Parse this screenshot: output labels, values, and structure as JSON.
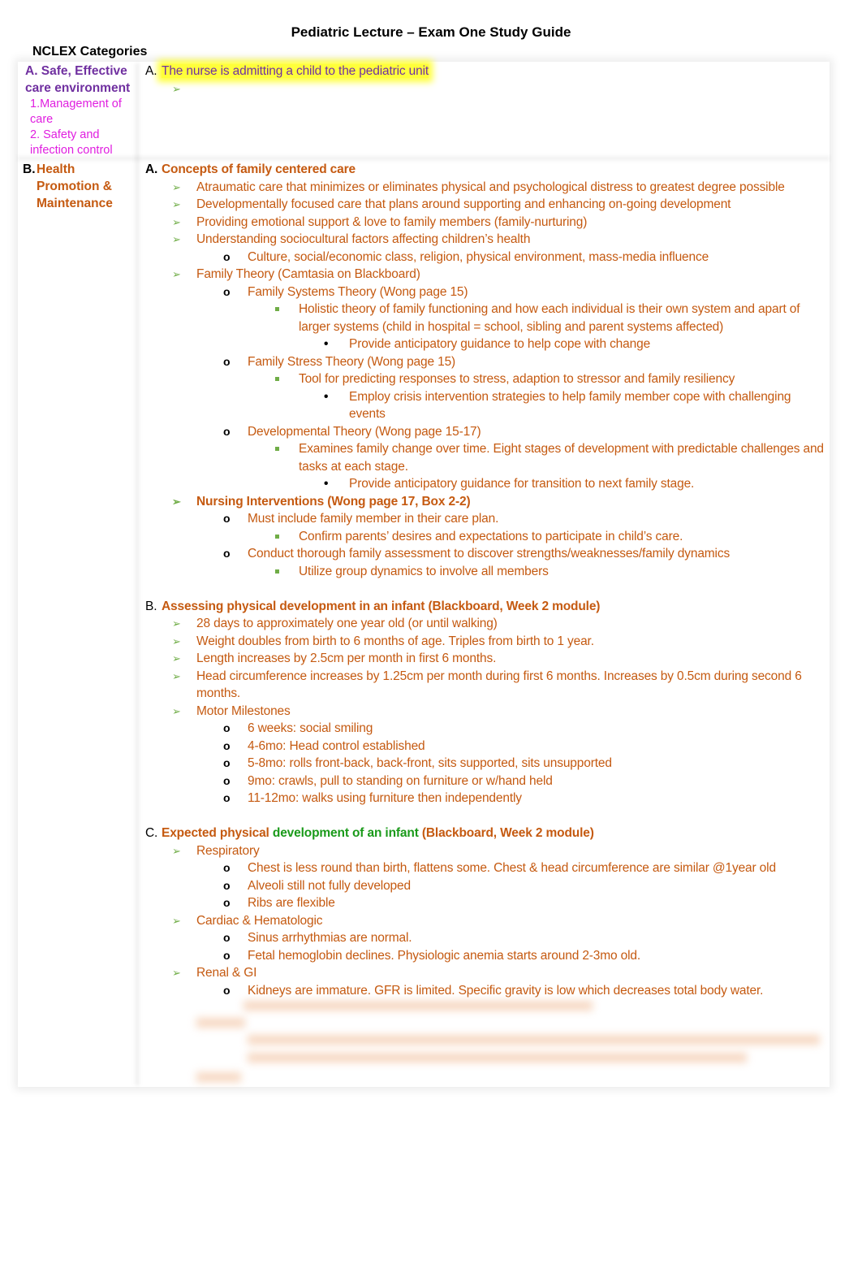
{
  "title": "Pediatric Lecture – Exam One Study Guide",
  "nclex_header": "NCLEX Categories",
  "left": {
    "a_label": "A. Safe, Effective care environment",
    "a_sub1": "1.Management of care",
    "a_sub2": "2. Safety and infection control",
    "b_marker": "B.",
    "b_label": "Health Promotion & Maintenance"
  },
  "colors": {
    "orange": "#c55a11",
    "purple": "#7030a0",
    "magenta": "#e01ee0",
    "arrow_green": "#70ad47",
    "text_green": "#1a9a1a",
    "highlight": "#ffff3a"
  },
  "icons": {
    "level1": "arrowhead-bullet-icon",
    "level2": "o-bullet",
    "level3": "square-bullet-icon",
    "level4": "dot-bullet-icon"
  },
  "row_a": {
    "label": "A.",
    "title": "The nurse is admitting a child to the pediatric unit",
    "items": [
      {
        "level": 1,
        "text": ""
      }
    ]
  },
  "sections": [
    {
      "label": "A.",
      "title": [
        {
          "t": "Concepts of family centered care"
        }
      ],
      "items": [
        {
          "level": 1,
          "text": "Atraumatic care that minimizes or eliminates physical and psychological distress to greatest degree possible"
        },
        {
          "level": 1,
          "text": "Developmentally focused care that plans around supporting and enhancing on-going development"
        },
        {
          "level": 1,
          "text": "Providing emotional support & love to family members (family-nurturing)"
        },
        {
          "level": 1,
          "text": "Understanding sociocultural factors affecting children’s health"
        },
        {
          "level": 2,
          "text": "Culture, social/economic class, religion, physical environment, mass-media influence"
        },
        {
          "level": 1,
          "text": "Family Theory (Camtasia on Blackboard)"
        },
        {
          "level": 2,
          "text": "Family Systems Theory (Wong page 15)"
        },
        {
          "level": 3,
          "text": "Holistic theory of family functioning and how each individual is their own system and apart of larger systems (child in hospital = school, sibling and parent systems affected)"
        },
        {
          "level": 4,
          "text": "Provide anticipatory guidance to help cope with change"
        },
        {
          "level": 2,
          "text": "Family Stress Theory (Wong page 15)"
        },
        {
          "level": 3,
          "text": "Tool for predicting responses to stress, adaption to stressor and family resiliency"
        },
        {
          "level": 4,
          "text": "Employ crisis intervention strategies to help family member cope with challenging events"
        },
        {
          "level": 2,
          "text": "Developmental Theory (Wong page 15-17)"
        },
        {
          "level": 3,
          "text": "Examines family change over time. Eight stages of development with predictable challenges and tasks at each stage."
        },
        {
          "level": 4,
          "text": "Provide anticipatory guidance for transition to next family stage."
        },
        {
          "level": 1,
          "text": "Nursing Interventions (Wong page 17, Box 2-2)",
          "bold": true
        },
        {
          "level": 2,
          "text": "Must include family member in their care plan."
        },
        {
          "level": 3,
          "text": "Confirm parents’ desires and expectations to participate in child’s care."
        },
        {
          "level": 2,
          "text": "Conduct thorough family assessment to discover strengths/weaknesses/family dynamics"
        },
        {
          "level": 3,
          "text": "Utilize group dynamics to involve all members"
        }
      ]
    },
    {
      "label": "B.",
      "title": [
        {
          "t": "Assessing physical development in an infant (Blackboard, Week 2 module)"
        }
      ],
      "items": [
        {
          "level": 1,
          "text": "28 days to approximately one year old (or until walking)"
        },
        {
          "level": 1,
          "text": "Weight doubles from birth to 6 months of age. Triples from birth to 1 year."
        },
        {
          "level": 1,
          "text": "Length increases by 2.5cm per month in first 6 months."
        },
        {
          "level": 1,
          "text": "Head circumference increases by 1.25cm per month during first 6 months. Increases by 0.5cm during second 6 months."
        },
        {
          "level": 1,
          "text": "Motor Milestones"
        },
        {
          "level": 2,
          "text": "6 weeks: social smiling"
        },
        {
          "level": 2,
          "text": "4-6mo: Head control established"
        },
        {
          "level": 2,
          "text": "5-8mo: rolls front-back, back-front, sits supported, sits unsupported"
        },
        {
          "level": 2,
          "text": "9mo: crawls, pull to standing on furniture or w/hand held"
        },
        {
          "level": 2,
          "text": "11-12mo: walks using furniture then independently"
        }
      ]
    },
    {
      "label": "C.",
      "title": [
        {
          "t": "Expected physical "
        },
        {
          "t": "development of an infant",
          "green": true
        },
        {
          "t": " (Blackboard, Week 2 module)"
        }
      ],
      "items": [
        {
          "level": 1,
          "text": "Respiratory"
        },
        {
          "level": 2,
          "text": "Chest is less round than birth, flattens some. Chest & head circumference are similar @1year old"
        },
        {
          "level": 2,
          "text": "Alveoli still not fully developed"
        },
        {
          "level": 2,
          "text": "Ribs are flexible"
        },
        {
          "level": 1,
          "text": "Cardiac & Hematologic"
        },
        {
          "level": 2,
          "text": "Sinus arrhythmias are normal."
        },
        {
          "level": 2,
          "text": "Fetal hemoglobin declines. Physiologic anemia starts around 2-3mo old."
        },
        {
          "level": 1,
          "text": "Renal & GI"
        },
        {
          "level": 2,
          "text": "Kidneys are immature. GFR is limited. Specific gravity is low which decreases total body water."
        }
      ]
    }
  ]
}
